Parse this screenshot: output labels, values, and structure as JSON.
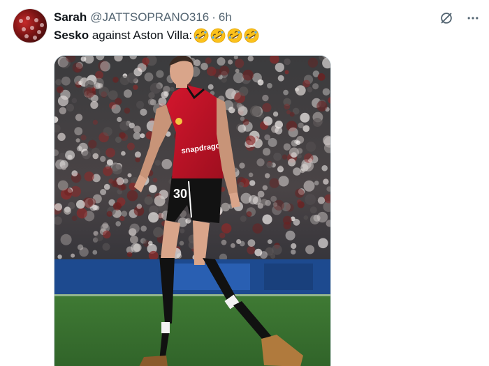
{
  "tweet": {
    "display_name": "Sarah",
    "handle": "@JATTSOPRANO316",
    "separator": "·",
    "timestamp": "6h",
    "text_bold": "Sesko",
    "text_rest": " against Aston Villa:",
    "emoji_icon": "rolling-on-floor-laughing-emoji",
    "emoji_count": 4
  },
  "media": {
    "jersey_number": "30",
    "sponsor": "snapdragon"
  },
  "colors": {
    "accent_text": "#0f1419",
    "muted_text": "#536471",
    "jersey_red": "#c8102e"
  }
}
